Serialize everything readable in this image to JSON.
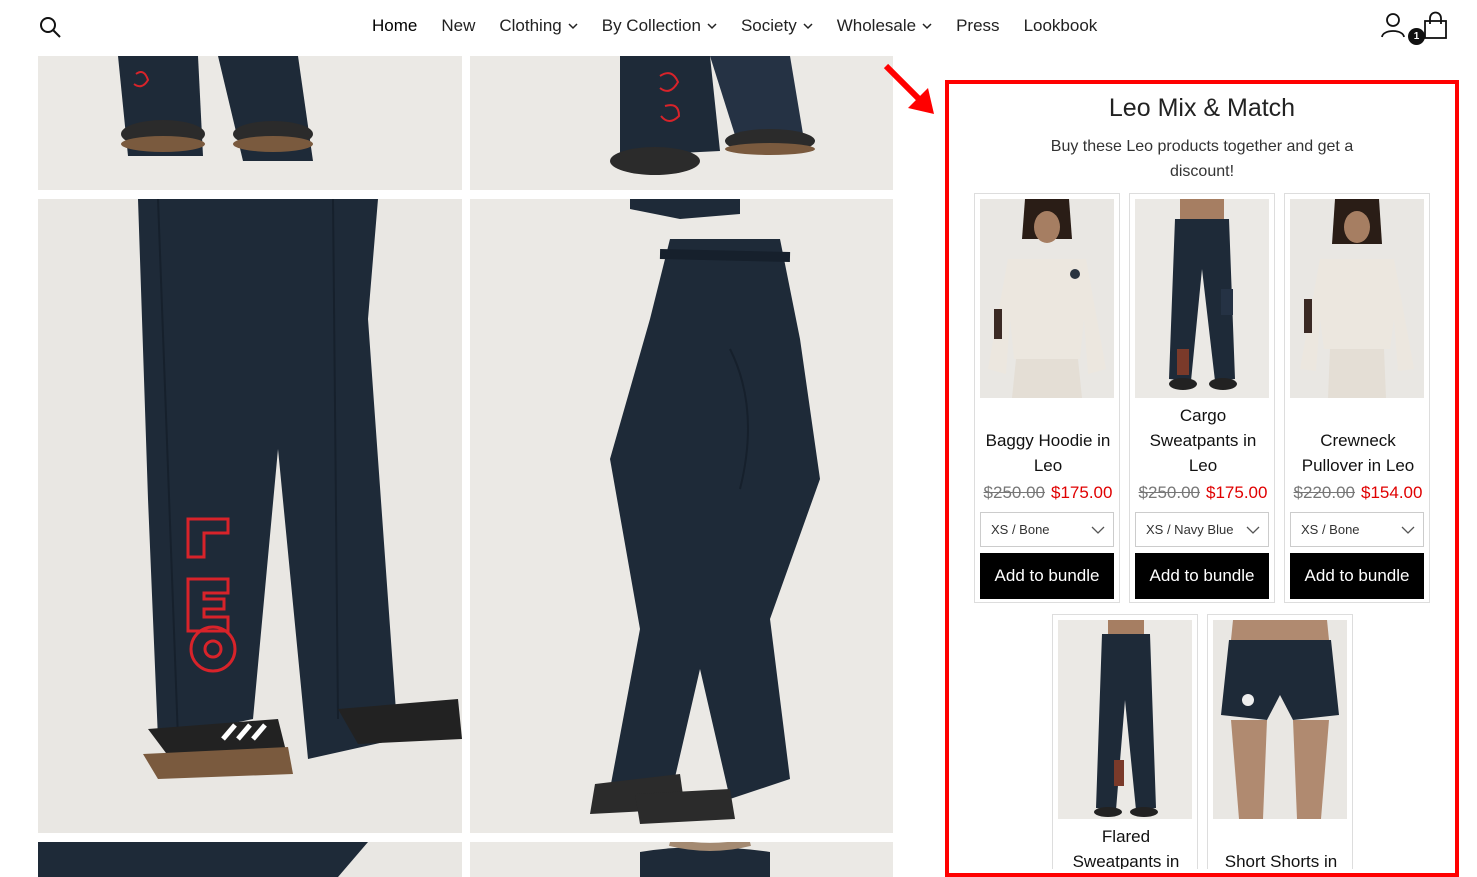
{
  "nav": {
    "items": [
      {
        "label": "Home",
        "has_dropdown": false,
        "active": true
      },
      {
        "label": "New",
        "has_dropdown": false,
        "active": false
      },
      {
        "label": "Clothing",
        "has_dropdown": true,
        "active": false
      },
      {
        "label": "By Collection",
        "has_dropdown": true,
        "active": false
      },
      {
        "label": "Society",
        "has_dropdown": true,
        "active": false
      },
      {
        "label": "Wholesale",
        "has_dropdown": true,
        "active": false
      },
      {
        "label": "Press",
        "has_dropdown": false,
        "active": false
      },
      {
        "label": "Lookbook",
        "has_dropdown": false,
        "active": false
      }
    ],
    "cart_count": "1"
  },
  "bundle": {
    "title": "Leo Mix & Match",
    "description": "Buy these Leo products together and get a discount!",
    "highlight_color": "#ff0000",
    "products": [
      {
        "name": "Baggy Hoodie in Leo",
        "old_price": "$250.00",
        "new_price": "$175.00",
        "variant": "XS / Bone",
        "button": "Add to bundle",
        "image": "hoodie-bone"
      },
      {
        "name": "Cargo Sweatpants in Leo",
        "old_price": "$250.00",
        "new_price": "$175.00",
        "variant": "XS / Navy Blue",
        "button": "Add to bundle",
        "image": "cargo-navy"
      },
      {
        "name": "Crewneck Pullover in Leo",
        "old_price": "$220.00",
        "new_price": "$154.00",
        "variant": "XS / Bone",
        "button": "Add to bundle",
        "image": "crewneck-bone"
      },
      {
        "name": "Flared Sweatpants in",
        "image": "flared-navy"
      },
      {
        "name": "Short Shorts in",
        "image": "shorts-navy"
      }
    ]
  },
  "colors": {
    "navy": "#1e2a38",
    "bone": "#ece7df",
    "sale_red": "#e00000",
    "embroidery_red": "#d8232a"
  }
}
